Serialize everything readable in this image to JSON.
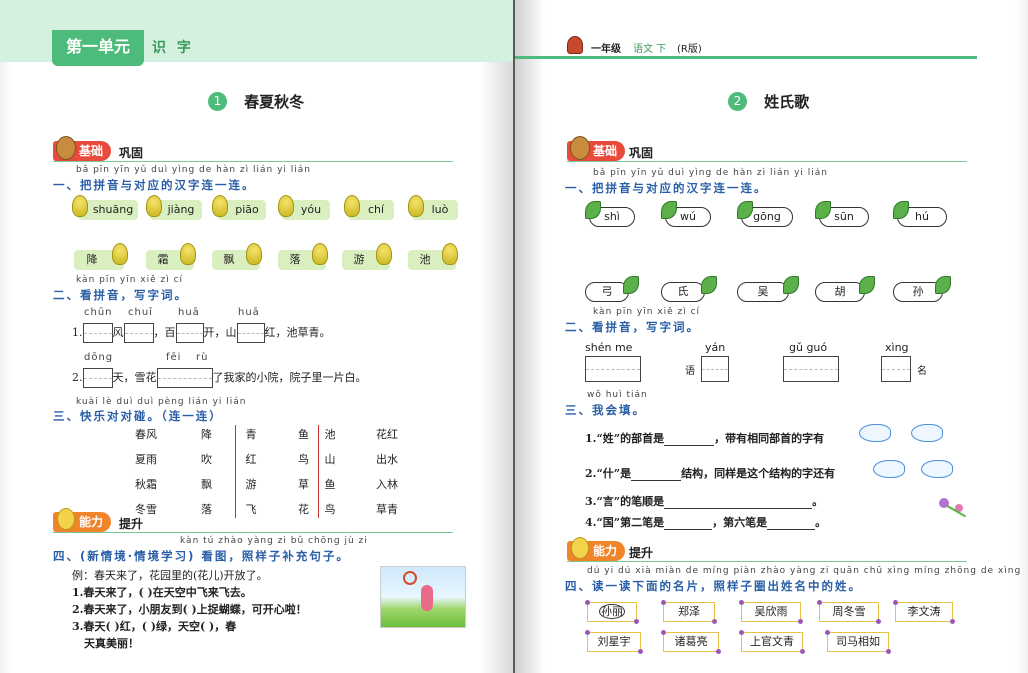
{
  "left": {
    "unit_title": "第一单元",
    "unit_sub": "识 字",
    "lesson_num": "1",
    "lesson_title": "春夏秋冬",
    "basic_tag": "基础",
    "basic_sub": "巩固",
    "q1": {
      "pinyin": "bǎ pīn yīn yǔ duì yìng de hàn zì lián yi lián",
      "text": "一、把拼音与对应的汉字连一连。",
      "syllables": [
        "shuāng",
        "jiàng",
        "piāo",
        "yóu",
        "chí",
        "luò"
      ],
      "chars": [
        "降",
        "霜",
        "飘",
        "落",
        "游",
        "池"
      ]
    },
    "q2": {
      "pinyin": "kàn pīn yīn   xiě zì cí",
      "text": "二、看拼音，写字词。",
      "line1_py": [
        "chūn",
        "chuī",
        "huā",
        "huā"
      ],
      "line1_num": "1.",
      "line1_a": "风",
      "line1_b": "，百",
      "line1_c": "开，山",
      "line1_d": "红，池草青。",
      "line2_py": [
        "dōng",
        "fēi",
        "rù"
      ],
      "line2_num": "2.",
      "line2_a": "天，雪花",
      "line2_b": "了我家的小院，院子里一片白。"
    },
    "q3": {
      "pinyin": "kuài lè duì duì pèng      lián yi lián",
      "text": "三、快乐对对碰。（连一连）",
      "left_col": [
        [
          "春风",
          "降",
          "青"
        ],
        [
          "夏雨",
          "吹",
          "红"
        ],
        [
          "秋霜",
          "飘",
          "游"
        ],
        [
          "冬雪",
          "落",
          "飞"
        ]
      ],
      "right_col": [
        [
          "鱼",
          "池",
          "花红"
        ],
        [
          "鸟",
          "山",
          "出水"
        ],
        [
          "草",
          "鱼",
          "入林"
        ],
        [
          "花",
          "鸟",
          "草青"
        ]
      ]
    },
    "ability_tag": "能力",
    "ability_sub": "提升",
    "q4": {
      "pinyin": "kàn tú   zhào yàng zi bǔ chōng jù zi",
      "text": "四、(新情境·情境学习) 看图，照样子补充句子。",
      "example": "例：春天来了，花园里的(花儿)开放了。",
      "l1": "1.春天来了，(        )在天空中飞来飞去。",
      "l2": "2.春天来了，小朋友到(        )上捉蝴蝶，可开心啦！",
      "l3": "3.春天(        )红，(        )绿，天空(        )，春",
      "l4": "天真美丽！"
    }
  },
  "right": {
    "header": "一年级",
    "header_subject": "语文 下",
    "header_edition": "(R版)",
    "lesson_num": "2",
    "lesson_title": "姓氏歌",
    "basic_tag": "基础",
    "basic_sub": "巩固",
    "q1": {
      "pinyin": "bǎ pīn yīn yǔ duì yìng de hàn zì lián yi lián",
      "text": "一、把拼音与对应的汉字连一连。",
      "syllables": [
        "shì",
        "wú",
        "gōng",
        "sūn",
        "hú"
      ],
      "chars": [
        "弓",
        "氏",
        "吴",
        "胡",
        "孙"
      ]
    },
    "q2": {
      "pinyin": "kàn pīn yīn   xiě zì cí",
      "text": "二、看拼音，写字词。",
      "items": [
        {
          "py": "shén me",
          "after": ""
        },
        {
          "py": "yán",
          "before": "语"
        },
        {
          "py": "gǔ guó",
          "after": ""
        },
        {
          "py": "xìng",
          "after": "名"
        }
      ]
    },
    "q3": {
      "pinyin": "wǒ huì tián",
      "text": "三、我会填。",
      "l1a": "1.“姓”的部首是",
      "l1b": "，带有相同部首的字有",
      "l2a": "2.“什”是",
      "l2b": "结构，同样是这个结构的字还有",
      "l3": "3.“言”的笔顺是",
      "l4a": "4.“国”第二笔是",
      "l4b": "，第六笔是"
    },
    "ability_tag": "能力",
    "ability_sub": "提升",
    "q4": {
      "pinyin": "dú yi dú xià miàn de míng piàn   zhào yàng zi quān chū xìng míng zhōng de xìng",
      "text": "四、读一读下面的名片，照样子圈出姓名中的姓。",
      "names_row1": [
        "孙丽",
        "郑泽",
        "吴欣雨",
        "周冬雪",
        "李文涛"
      ],
      "names_row2": [
        "刘星宇",
        "诸葛亮",
        "上官文青",
        "司马相如"
      ]
    }
  }
}
